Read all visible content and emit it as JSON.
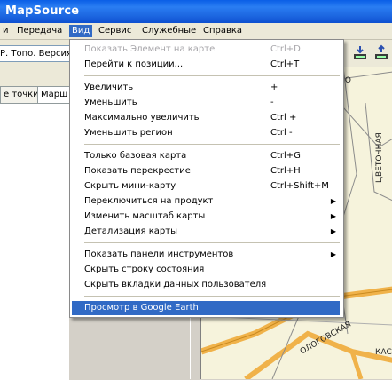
{
  "window": {
    "title": "MapSource"
  },
  "menubar": {
    "items": [
      {
        "label": "и",
        "active": false
      },
      {
        "label": "Передача",
        "active": false
      },
      {
        "label": "Вид",
        "active": true
      },
      {
        "label": "Сервис",
        "active": false
      },
      {
        "label": "Служебные",
        "active": false
      },
      {
        "label": "Справка",
        "active": false
      }
    ]
  },
  "toolbar": {
    "map_select_value": "Р. Топо. Версия"
  },
  "left_panel": {
    "tabs": [
      {
        "label": "е точки"
      },
      {
        "label": "Марш"
      }
    ]
  },
  "view_menu": {
    "groups": [
      [
        {
          "label": "Показать Элемент на карте",
          "shortcut": "Ctrl+D",
          "disabled": true
        },
        {
          "label": "Перейти к позиции...",
          "shortcut": "Ctrl+T"
        }
      ],
      [
        {
          "label": "Увеличить",
          "shortcut": "+"
        },
        {
          "label": "Уменьшить",
          "shortcut": "-"
        },
        {
          "label": "Максимально увеличить",
          "shortcut": "Ctrl +"
        },
        {
          "label": "Уменьшить регион",
          "shortcut": "Ctrl -"
        }
      ],
      [
        {
          "label": "Только базовая карта",
          "shortcut": "Ctrl+G"
        },
        {
          "label": "Показать перекрестие",
          "shortcut": "Ctrl+H"
        },
        {
          "label": "Скрыть мини-карту",
          "shortcut": "Ctrl+Shift+M"
        },
        {
          "label": "Переключиться на продукт",
          "submenu": true
        },
        {
          "label": "Изменить масштаб карты",
          "submenu": true
        },
        {
          "label": "Детализация карты",
          "submenu": true
        }
      ],
      [
        {
          "label": "Показать панели инструментов",
          "submenu": true
        },
        {
          "label": "Скрыть строку состояния"
        },
        {
          "label": "Скрыть вкладки данных пользователя"
        }
      ],
      [
        {
          "label": "Просмотр в Google Earth",
          "highlighted": true
        }
      ]
    ]
  },
  "map": {
    "labels": [
      "КИНО",
      "ЦВЕТОЧНАЯ",
      "ОЛОГОВСКАЯ",
      "КАС"
    ]
  },
  "colors": {
    "titlebar": "#0a5ee6",
    "menu_highlight": "#316ac5",
    "map_background": "#f6f3dc",
    "road_major": "#f0b24a",
    "road_minor": "#8c8c8c"
  }
}
